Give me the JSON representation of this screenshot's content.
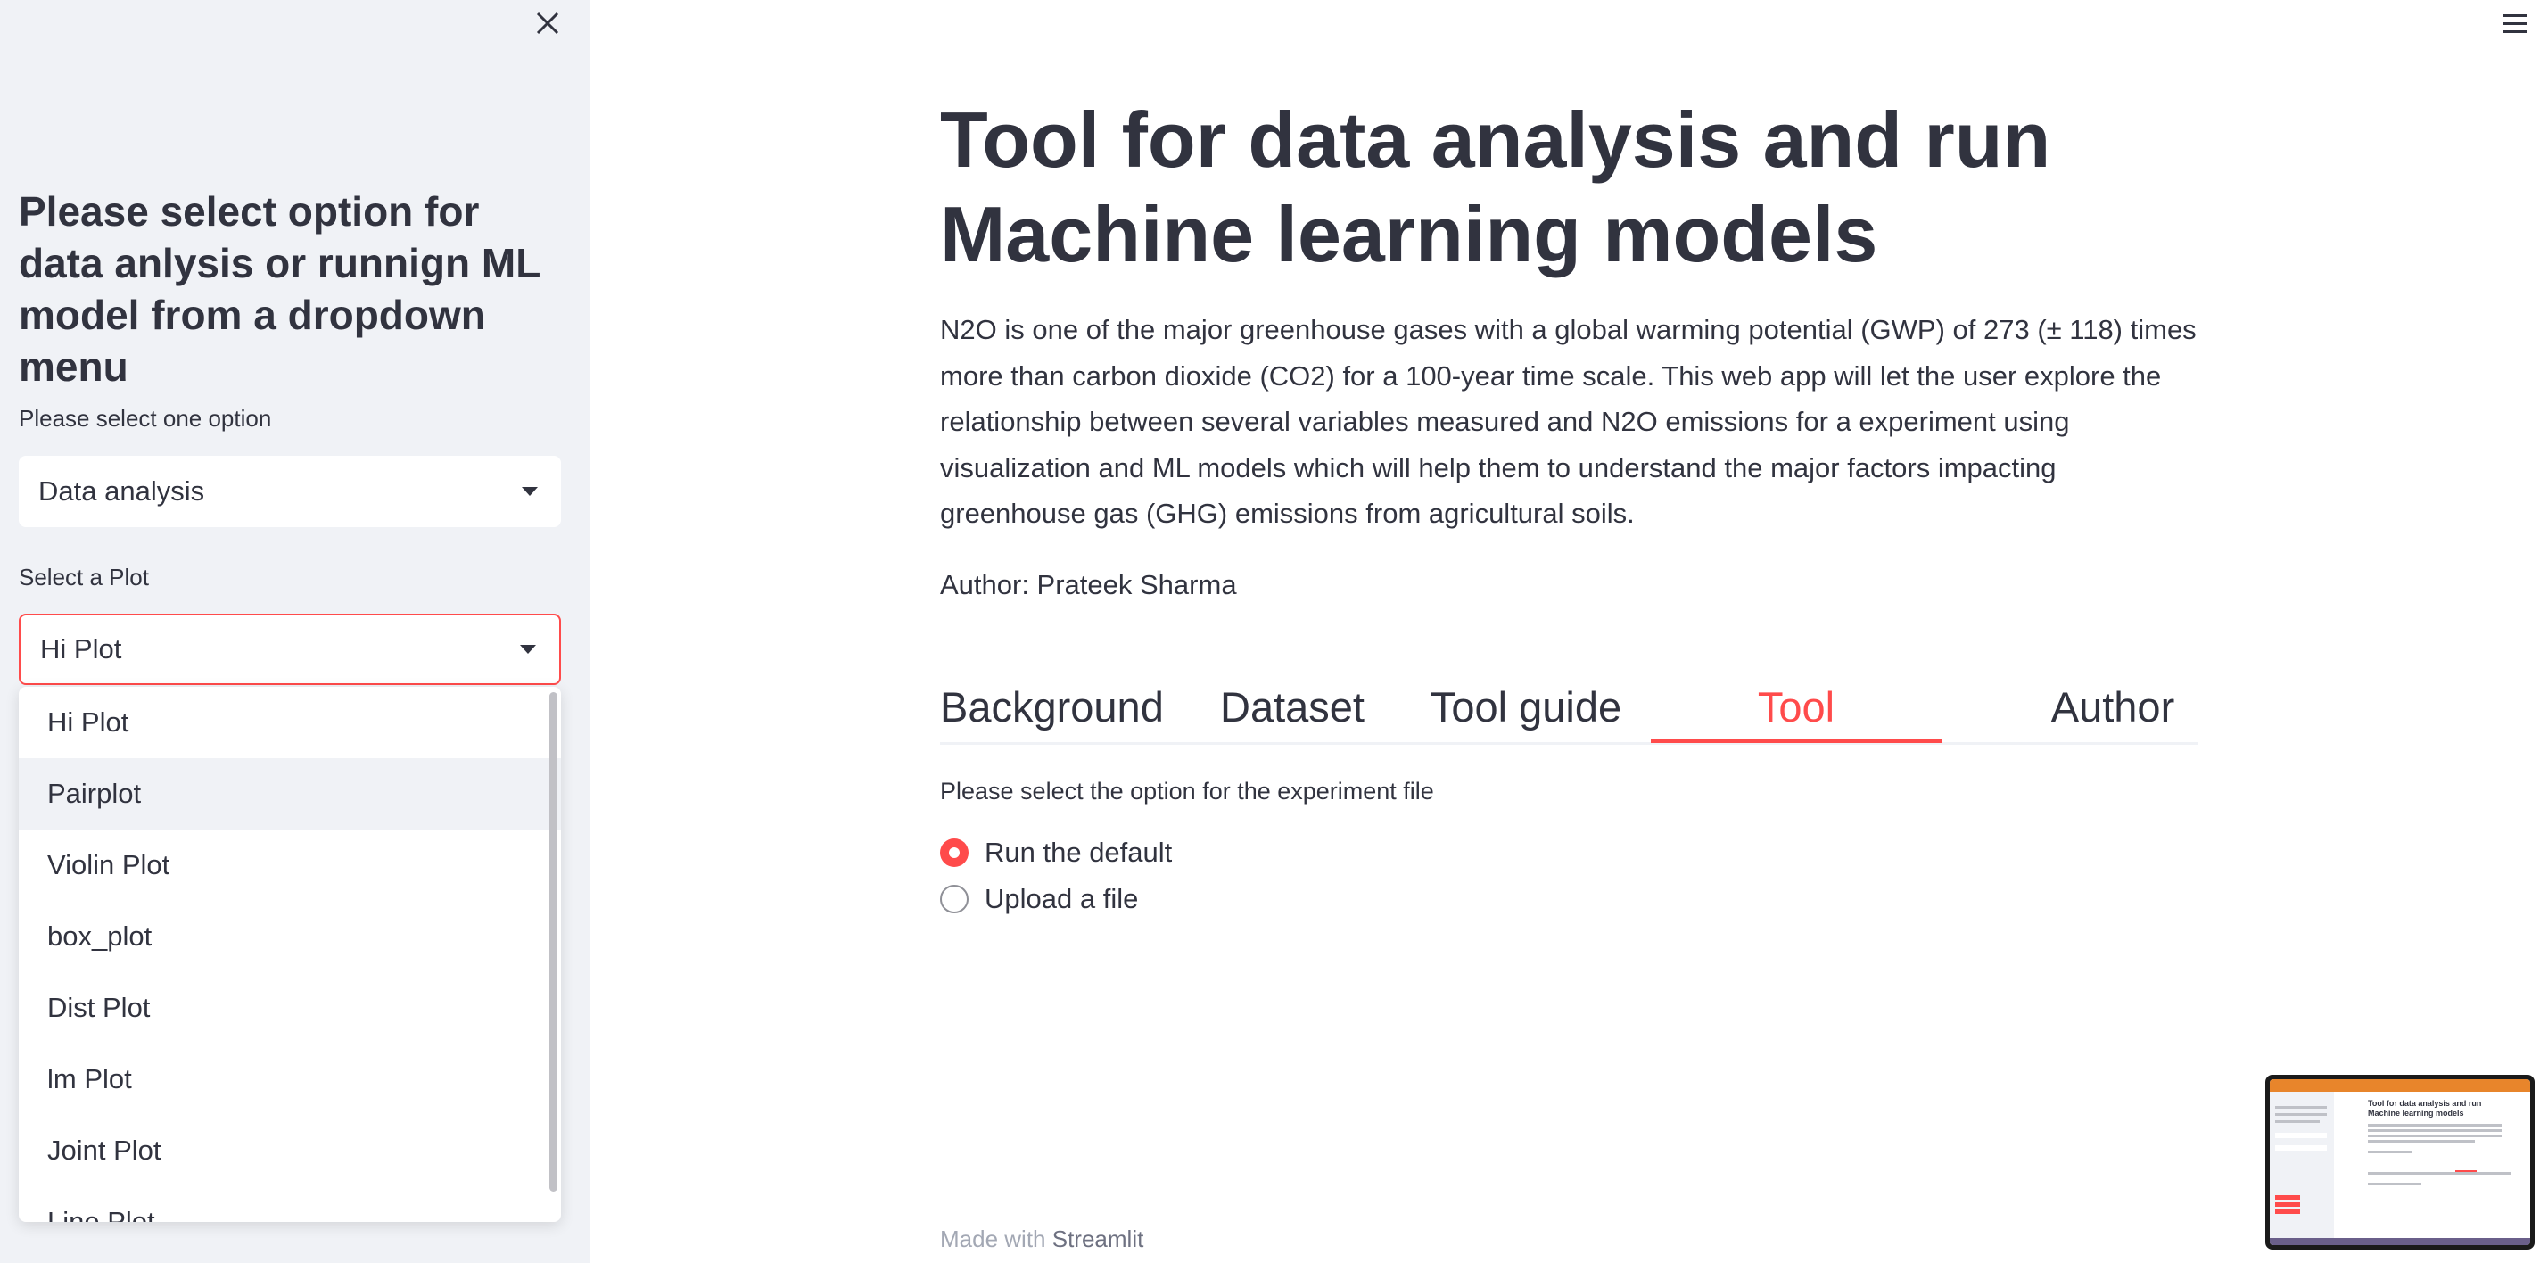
{
  "sidebar": {
    "heading": "Please select option for data anlysis or runnign ML model from a dropdown menu",
    "option_label": "Please select one option",
    "option_value": "Data analysis",
    "plot_label": "Select a Plot",
    "plot_value": "Hi Plot",
    "plot_options": [
      "Hi Plot",
      "Pairplot",
      "Violin Plot",
      "box_plot",
      "Dist Plot",
      "lm Plot",
      "Joint Plot",
      "Line Plot"
    ],
    "highlighted_option": "Pairplot"
  },
  "main": {
    "title": "Tool for data analysis and run Machine learning models",
    "description": "N2O is one of the major greenhouse gases with a global warming potential (GWP) of 273 (± 118) times more than carbon dioxide (CO2) for a 100-year time scale. This web app will let the user explore the relationship between several variables measured and N2O emissions for a experiment using visualization and ML models which will help them to understand the major factors impacting greenhouse gas (GHG) emissions from agricultural soils.",
    "author": "Author: Prateek Sharma",
    "tabs": [
      "Background",
      "Dataset",
      "Tool guide",
      "Tool",
      "Author"
    ],
    "active_tab": "Tool",
    "radio_label": "Please select the option for the experiment file",
    "radio_options": [
      "Run the default",
      "Upload a file"
    ],
    "radio_selected": "Run the default"
  },
  "footer": {
    "prefix": "Made with",
    "brand": "Streamlit"
  },
  "thumbnail": {
    "title_line1": "Tool for data analysis and run",
    "title_line2": "Machine learning models"
  },
  "colors": {
    "accent": "#ff4b4b",
    "sidebar_bg": "#f0f2f6",
    "text": "#31333f"
  },
  "icons": {
    "close": "close-icon",
    "menu": "hamburger-menu-icon",
    "caret": "chevron-down-icon"
  }
}
